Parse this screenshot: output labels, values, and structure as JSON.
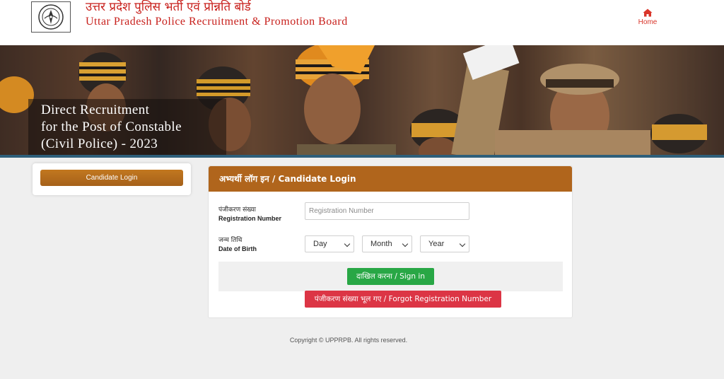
{
  "header": {
    "title_hindi": "उत्तर प्रदेश पुलिस भर्ती एवं प्रोन्नति बोर्ड",
    "title_english": "Uttar Pradesh Police Recruitment & Promotion Board",
    "logo_icon": "upprpb-emblem-icon",
    "home": {
      "label": "Home",
      "icon": "home-icon"
    },
    "accent_color": "#c8211d"
  },
  "banner": {
    "lines": [
      "Direct Recruitment",
      "for the Post of Constable",
      "(Civil Police) - 2023"
    ]
  },
  "sidebar": {
    "candidate_login_label": "Candidate Login",
    "button_color": "#b0651c"
  },
  "login": {
    "title": "अभ्यर्थी लॉग इन / Candidate Login",
    "registration": {
      "label_hindi": "पंजीकरण संख्या",
      "label_english": "Registration Number",
      "value": "",
      "placeholder": "Registration Number"
    },
    "dob": {
      "label_hindi": "जन्म तिथि",
      "label_english": "Date of Birth",
      "day": "Day",
      "month": "Month",
      "year": "Year"
    },
    "signin_label": "दाखिल करना / Sign in",
    "forgot_label": "पंजीकरण संख्या भूल गए / Forgot Registration Number",
    "signin_color": "#28a745",
    "forgot_color": "#dc3545"
  },
  "footer": {
    "copyright": "Copyright © UPPRPB. All rights reserved."
  }
}
